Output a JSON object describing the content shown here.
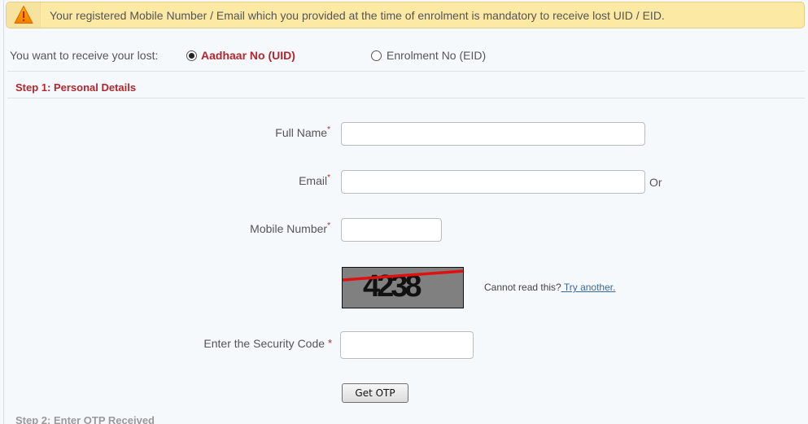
{
  "alert": {
    "icon": "warning-icon",
    "message": "Your registered Mobile Number / Email which you provided at the time of enrolment is mandatory to receive lost UID / EID."
  },
  "receive": {
    "label": "You want to receive your lost:",
    "options": [
      {
        "label": "Aadhaar No (UID)",
        "selected": true
      },
      {
        "label": "Enrolment No (EID)",
        "selected": false
      }
    ]
  },
  "step1": {
    "title": "Step 1: Personal Details",
    "fields": {
      "full_name": {
        "label": "Full Name",
        "required_mark": "*",
        "value": ""
      },
      "email": {
        "label": "Email",
        "required_mark": "*",
        "value": "",
        "suffix": "Or"
      },
      "mobile": {
        "label": "Mobile Number",
        "required_mark": "*",
        "value": ""
      },
      "security_code": {
        "label": "Enter the Security Code ",
        "required_mark": "*",
        "value": ""
      }
    },
    "captcha": {
      "code": "4238",
      "cannot_read": "Cannot read this?",
      "try_another": " Try another."
    },
    "get_otp_label": "Get OTP"
  },
  "step2": {
    "title": "Step 2: Enter OTP Received"
  },
  "colors": {
    "accent_red": "#b3262d",
    "alert_bg": "#fbe9a4",
    "link": "#3b6a99"
  }
}
